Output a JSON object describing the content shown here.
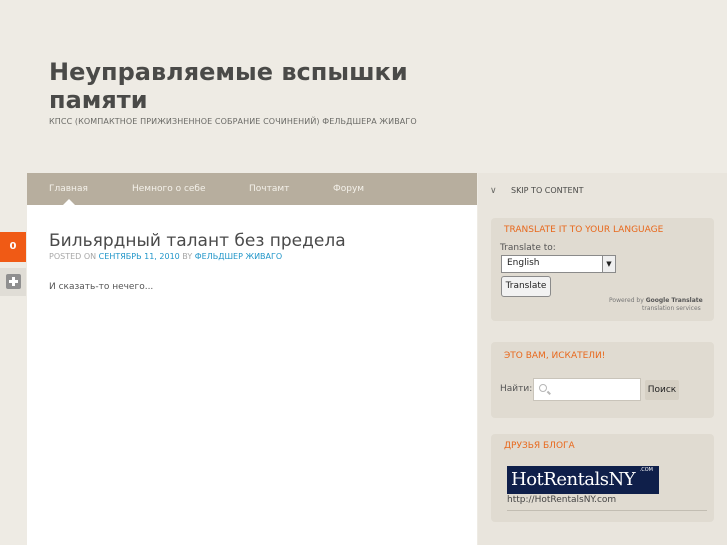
{
  "header": {
    "title": "Неуправляемые вспышки памяти",
    "description": "КПСС (Компактное Прижизненное Собрание Сочинений) фельдшера Живаго"
  },
  "nav": {
    "items": [
      {
        "label": "Главная"
      },
      {
        "label": "Немного о себе"
      },
      {
        "label": "Почтамт"
      },
      {
        "label": "Форум"
      }
    ]
  },
  "post": {
    "title": "Бильярдный талант без предела",
    "meta_posted": "Posted on",
    "meta_date": "Сентябрь 11, 2010",
    "meta_by": "by",
    "meta_author": "Фельдшер Живаго",
    "body": "И сказать-то нечего..."
  },
  "share": {
    "count": "0"
  },
  "sidebar": {
    "skip_link": "Skip to content",
    "translate": {
      "title": "Translate it to your language",
      "label": "Translate to:",
      "selected_language": "English",
      "button": "Translate",
      "powered_by": "Powered by",
      "google_translate": "Google Translate",
      "services": "translation services"
    },
    "search": {
      "title": "Это вам, искатели!",
      "label": "Найти:",
      "button": "Поиск",
      "value": ""
    },
    "friends": {
      "title": "Друзья блога",
      "banner_text": "HotRentalsNY",
      "banner_dotcom": ".COM",
      "banner_url": "http://HotRentalsNY.com"
    }
  },
  "colors": {
    "accent": "#e8681c",
    "nav_bg": "#b7ae9e",
    "link": "#2196c9",
    "share_count_bg": "#f05a15"
  }
}
